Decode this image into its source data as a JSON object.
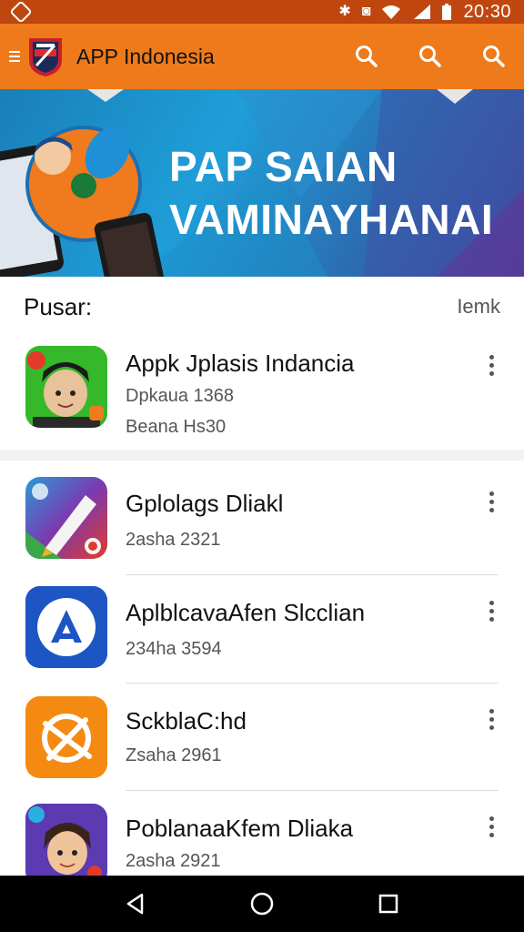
{
  "status_bar": {
    "time": "20:30"
  },
  "app_bar": {
    "title": "APP Indonesia"
  },
  "banner": {
    "line1": "PAP SAIAN",
    "line2": "VAMINAYHANAI"
  },
  "section": {
    "title": "Pusar:",
    "link": "Iemk"
  },
  "featured": {
    "name": "Appk Jplasis Indancia",
    "line1": "Dpkaua 1368",
    "line2": "Beana Hs30"
  },
  "apps": [
    {
      "name": "Gplolags Dliakl",
      "sub": "2asha 2321"
    },
    {
      "name": "AplblcavaAfen Slcclian",
      "sub": "234ha 3594"
    },
    {
      "name": "SckblaC:hd",
      "sub": "Zsaha 2961"
    },
    {
      "name": "PoblanaaKfem Dliaka",
      "sub": "2asha 2921"
    }
  ],
  "colors": {
    "status_bar": "#c0460f",
    "app_bar": "#ee7a1c",
    "nav_bar": "#000000"
  }
}
